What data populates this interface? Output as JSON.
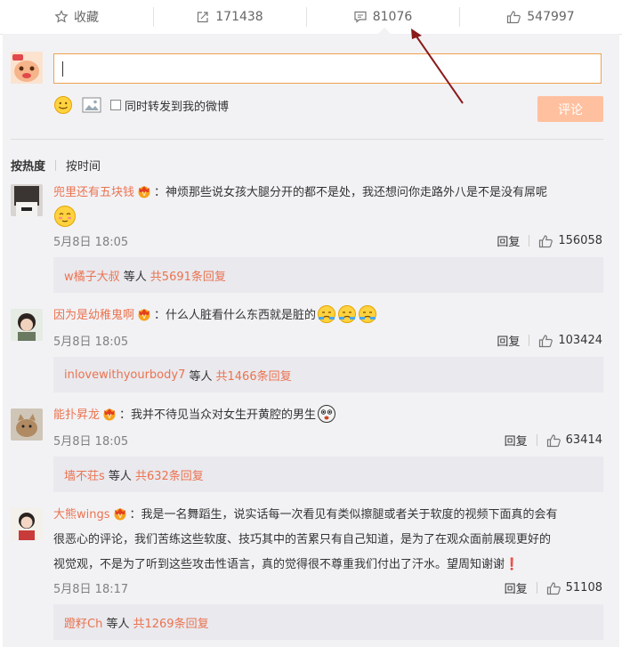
{
  "toolbar": {
    "favorite_label": "收藏",
    "forward_count": "171438",
    "comment_count": "81076",
    "like_count": "547997",
    "favorite_icon": "star-icon",
    "forward_icon": "forward-icon",
    "comment_icon": "comment-icon",
    "like_icon": "thumbs-up-icon"
  },
  "composer": {
    "input_value": "",
    "sync_label": "同时转发到我的微博",
    "submit_label": "评论"
  },
  "sort": {
    "hot_label": "按热度",
    "time_label": "按时间"
  },
  "comments": [
    {
      "user": "兜里还有五块钱",
      "text": "：神烦那些说女孩大腿分开的都不是处，我还想问你走路外八是不是没有屌呢",
      "date": "5月8日 18:05",
      "reply_label": "回复",
      "likes": "156058",
      "reply_user": "w橘子大叔",
      "reply_mid": "等人",
      "reply_count": "共5691条回复"
    },
    {
      "user": "因为是幼稚鬼啊",
      "text": "：什么人脏看什么东西就是脏的",
      "date": "5月8日 18:05",
      "reply_label": "回复",
      "likes": "103424",
      "reply_user": "inlovewithyourbody7",
      "reply_mid": "等人",
      "reply_count": "共1466条回复"
    },
    {
      "user": "能扑昇龙",
      "text": "：我并不待见当众对女生开黄腔的男生",
      "date": "5月8日 18:05",
      "reply_label": "回复",
      "likes": "63414",
      "reply_user": "墙不荘s",
      "reply_mid": "等人",
      "reply_count": "共632条回复"
    },
    {
      "user": "大熊wings",
      "text_line1": "：我是一名舞蹈生，说实话每一次看见有类似擦腿或者关于软度的视频下面真的会有",
      "text_line2": "很恶心的评论，我们苦练这些软度、技巧其中的苦累只有自己知道，是为了在观众面前展现更好的",
      "text_line3": "视觉观，不是为了听到这些攻击性语言，真的觉得很不尊重我们付出了汗水。望周知谢谢❗",
      "date": "5月8日 18:17",
      "reply_label": "回复",
      "likes": "51108",
      "reply_user": "蹬籽Ch",
      "reply_mid": "等人",
      "reply_count": "共1269条回复"
    }
  ],
  "colors": {
    "accent": "#eb7350",
    "submit_bg": "#ffc09f",
    "arrow": "#8b1a1a",
    "input_border": "#f0a050"
  }
}
